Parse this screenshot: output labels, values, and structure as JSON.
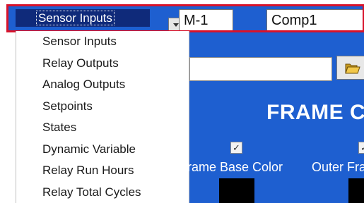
{
  "toolbar": {
    "selected_input_type": "Sensor Inputs",
    "device_field": "M-1",
    "component_field": "Comp1"
  },
  "dropdown": {
    "items": [
      {
        "label": "Sensor Inputs"
      },
      {
        "label": "Relay Outputs"
      },
      {
        "label": "Analog Outputs"
      },
      {
        "label": "Setpoints"
      },
      {
        "label": "States"
      },
      {
        "label": "Dynamic Variable"
      },
      {
        "label": "Relay Run Hours"
      },
      {
        "label": "Relay Total Cycles"
      }
    ]
  },
  "frame": {
    "title": "FRAME C",
    "frame_base_color_label": "rame Base Color",
    "outer_frame_label": "Outer Fra",
    "frame_base_color_checked": true,
    "outer_frame_checked": true
  },
  "colors": {
    "panel_blue": "#1e5fd0",
    "selection_navy": "#0f2a7a",
    "highlight_red": "#d8122a",
    "swatch": "#000000"
  },
  "icons": {
    "dropdown_arrow": "chevron-down-icon",
    "folder": "folder-open-icon"
  }
}
